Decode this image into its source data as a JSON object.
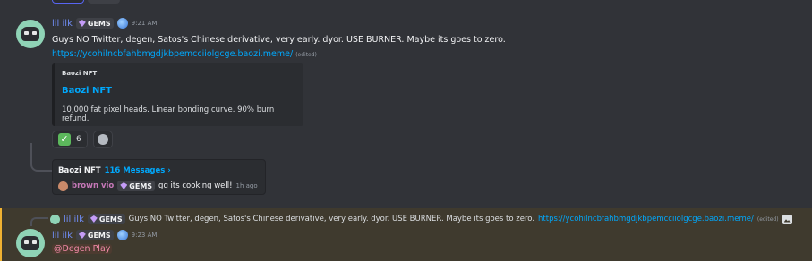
{
  "message1": {
    "username": "lil ilk",
    "tag": "GEMS",
    "time": "9:21 AM",
    "text": "Guys NO Twitter, degen, Satos's Chinese derivative, very early. dyor. USE BURNER. Maybe its goes to zero.",
    "link": "https://ycohilncbfahbmgdjkbpemcciiolgcge.baozi.meme/",
    "edited": "(edited)"
  },
  "embed": {
    "provider": "Baozi NFT",
    "title": "Baozi NFT",
    "description": "10,000 fat pixel heads. Linear bonding curve. 90% burn refund."
  },
  "reactions": [
    {
      "icon": "check-emoji",
      "count": "6"
    }
  ],
  "thread": {
    "name": "Baozi NFT",
    "count": "116 Messages ›",
    "last_author": "brown vio",
    "last_author_tag": "GEMS",
    "last_message": "gg its cooking well!",
    "last_time": "1h ago"
  },
  "reply_preview": {
    "username": "lil ilk",
    "tag": "GEMS",
    "text": "Guys NO Twitter, degen, Satos's Chinese derivative, very early. dyor. USE BURNER. Maybe its goes to zero.",
    "link": "https://ycohilncbfahbmgdjkbpemcciiolgcge.baozi.meme/",
    "edited": "(edited)"
  },
  "message2": {
    "username": "lil ilk",
    "tag": "GEMS",
    "time": "9:23 AM",
    "mention": "@Degen Play"
  },
  "colors": {
    "background": "#313338",
    "link": "#00a8fc",
    "username": "#6f8cf2",
    "mention_highlight": "#3f3a2e",
    "mention_border": "#f0b232"
  }
}
